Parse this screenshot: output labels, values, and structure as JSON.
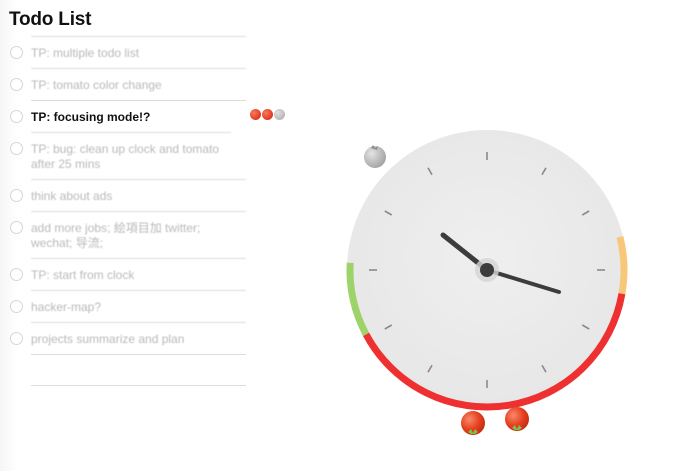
{
  "app": {
    "title": "Todo List"
  },
  "todos": [
    {
      "label": "TP: multiple todo list",
      "active": false
    },
    {
      "label": "TP: tomato color change",
      "active": false
    },
    {
      "label": "TP: focusing mode!?",
      "active": true
    },
    {
      "label": "TP: bug: clean up clock and tomato after 25 mins",
      "active": false
    },
    {
      "label": "think about ads",
      "active": false
    },
    {
      "label": "add more jobs; 絵項目加 twitter; wechat; 导流;",
      "active": false
    },
    {
      "label": "TP: start from clock",
      "active": false
    },
    {
      "label": "hacker-map?",
      "active": false
    },
    {
      "label": "projects summarize and plan",
      "active": false
    }
  ],
  "focused_todo_tomatoes": [
    {
      "state": "done",
      "color": "#e8452b"
    },
    {
      "state": "done",
      "color": "#e8452b"
    },
    {
      "state": "pending",
      "color": "#c8c8c8"
    }
  ],
  "clock": {
    "time_shown": "10:21",
    "face_color": "#ebebeb",
    "tick_color": "#8a8a8a",
    "hand_color": "#3c3c3c",
    "arcs": [
      {
        "name": "done",
        "color": "#ee3030"
      },
      {
        "name": "rest",
        "color": "#9ed36a"
      },
      {
        "name": "short",
        "color": "#f7c87a"
      }
    ]
  },
  "tomatoes": [
    {
      "name": "grey-tomato",
      "color": "#bdbdbd"
    },
    {
      "name": "red-tomato-1",
      "color": "#e8452b"
    },
    {
      "name": "red-tomato-2",
      "color": "#e8452b"
    }
  ],
  "colors": {
    "accent_red": "#ee3030",
    "accent_green": "#9ed36a",
    "accent_yellow": "#f7c87a"
  }
}
